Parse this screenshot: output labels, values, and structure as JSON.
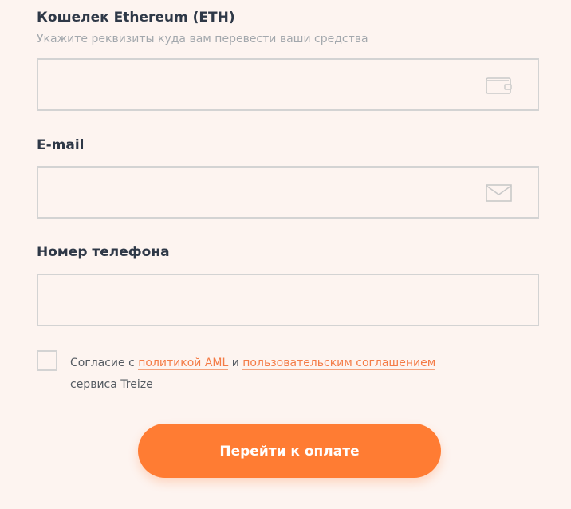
{
  "wallet": {
    "label": "Кошелек Ethereum (ETH)",
    "hint": "Укажите реквизиты куда вам перевести ваши средства",
    "value": "",
    "icon": "wallet-icon"
  },
  "email": {
    "label": "E-mail",
    "value": "",
    "icon": "mail-icon"
  },
  "phone": {
    "label": "Номер телефона",
    "value": ""
  },
  "consent": {
    "text_before": "Согласие с ",
    "aml_link": "политикой AML",
    "text_and": " и ",
    "agreement_link": "пользовательским соглашением",
    "text_after": " сервиса Treize",
    "checked": false
  },
  "submit": {
    "label": "Перейти к оплате"
  },
  "colors": {
    "background": "#fdf4f0",
    "accent": "#ff7c33",
    "link": "#f47c47",
    "border": "#d3d3d3",
    "label": "#2e3847"
  }
}
